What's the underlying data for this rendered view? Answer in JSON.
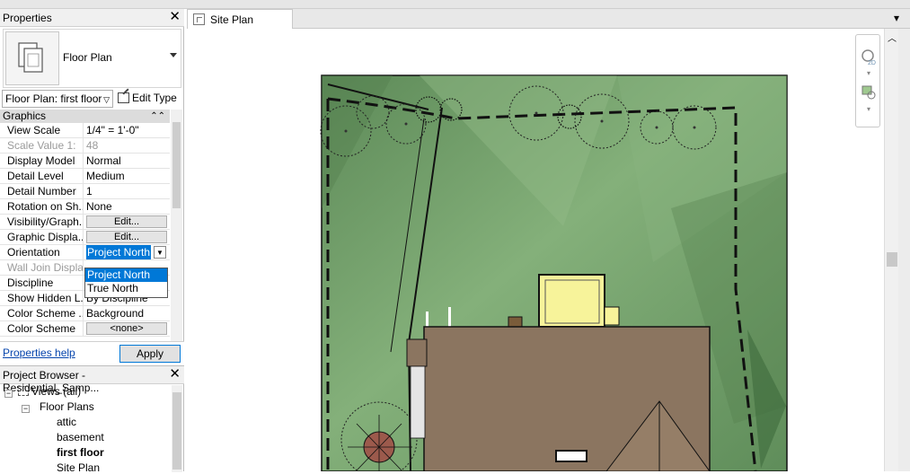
{
  "properties": {
    "title": "Properties",
    "type_name": "Floor Plan",
    "instance_selector": "Floor Plan: first floor",
    "edit_type_label": "Edit Type",
    "group_label": "Graphics",
    "rows": [
      {
        "name": "View Scale",
        "value": "1/4\" = 1'-0\""
      },
      {
        "name": "Scale Value",
        "value": "48",
        "extra": "1:"
      },
      {
        "name": "Display Model",
        "value": "Normal"
      },
      {
        "name": "Detail Level",
        "value": "Medium"
      },
      {
        "name": "Detail Number",
        "value": "1"
      },
      {
        "name": "Rotation on Sh...",
        "value": "None"
      },
      {
        "name": "Visibility/Graph...",
        "value": "Edit..."
      },
      {
        "name": "Graphic Displa...",
        "value": "Edit..."
      },
      {
        "name": "Orientation",
        "value": "Project North"
      },
      {
        "name": "Wall Join Display",
        "value": ""
      },
      {
        "name": "Discipline",
        "value": ""
      },
      {
        "name": "Show Hidden L...",
        "value": "By Discipline"
      },
      {
        "name": "Color Scheme ...",
        "value": "Background"
      },
      {
        "name": "Color Scheme",
        "value": "<none>"
      }
    ],
    "orientation_options": [
      "Project North",
      "True North"
    ],
    "help_link": "Properties help",
    "apply_label": "Apply"
  },
  "project_browser": {
    "title": "Project Browser - Residential_Samp...",
    "items": [
      {
        "label": "Views (all)",
        "level": 0
      },
      {
        "label": "Floor Plans",
        "level": 1
      },
      {
        "label": "attic",
        "level": 2
      },
      {
        "label": "basement",
        "level": 2
      },
      {
        "label": "first floor",
        "level": 2,
        "bold": true
      },
      {
        "label": "Site Plan",
        "level": 2
      }
    ]
  },
  "view": {
    "tab_label": "Site Plan",
    "navbar_label": "2D"
  },
  "colors": {
    "site_green": "#6f9a66",
    "roof_brown": "#8b7560",
    "roof_dark": "#6e5a48",
    "highlight": "#0078d7",
    "house_yellow": "#f7f39a"
  }
}
